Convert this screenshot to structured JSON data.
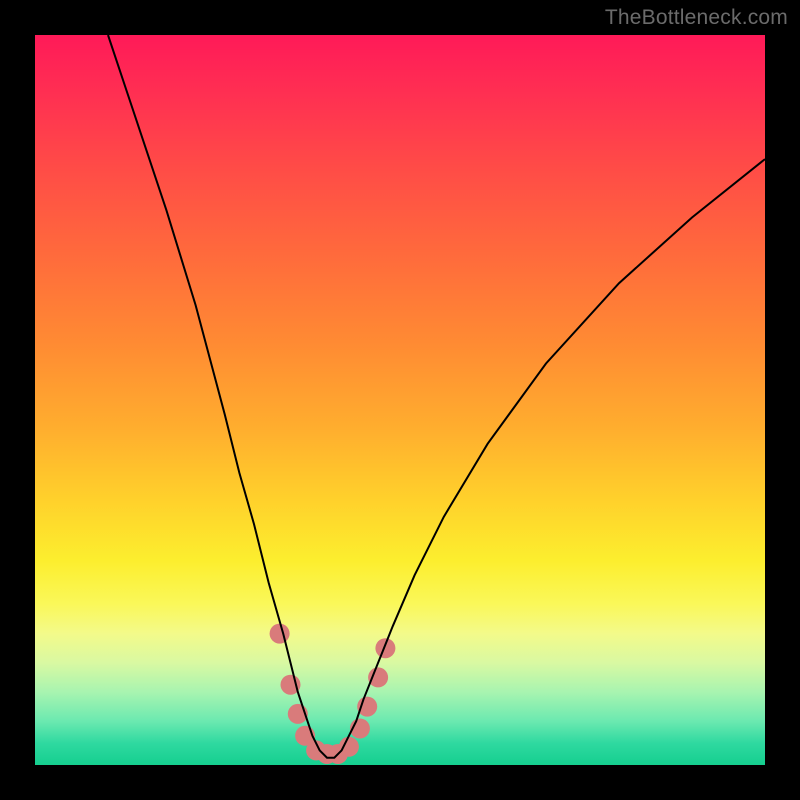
{
  "watermark": {
    "text": "TheBottleneck.com"
  },
  "chart_data": {
    "type": "line",
    "title": "",
    "xlabel": "",
    "ylabel": "",
    "xlim": [
      0,
      100
    ],
    "ylim": [
      0,
      100
    ],
    "grid": false,
    "legend": false,
    "background_gradient": {
      "direction": "vertical",
      "stops": [
        {
          "pos": 0,
          "color": "#ff1a58"
        },
        {
          "pos": 30,
          "color": "#ff6a3c"
        },
        {
          "pos": 64,
          "color": "#ffd22b"
        },
        {
          "pos": 82,
          "color": "#f3fa8a"
        },
        {
          "pos": 100,
          "color": "#15cf8f"
        }
      ]
    },
    "series": [
      {
        "name": "bottleneck-curve",
        "color": "#000000",
        "stroke_width": 2,
        "x": [
          10,
          14,
          18,
          22,
          26,
          28,
          30,
          32,
          34,
          35,
          36,
          37,
          38,
          39,
          40,
          41,
          42,
          43,
          44,
          45,
          47,
          49,
          52,
          56,
          62,
          70,
          80,
          90,
          100
        ],
        "y": [
          100,
          88,
          76,
          63,
          48,
          40,
          33,
          25,
          18,
          14,
          10,
          7,
          4,
          2,
          1,
          1,
          2,
          4,
          6,
          9,
          14,
          19,
          26,
          34,
          44,
          55,
          66,
          75,
          83
        ]
      }
    ],
    "markers": {
      "name": "highlight-dots",
      "color": "#d97b7b",
      "shape": "circle",
      "radius_px": 10,
      "points": [
        {
          "x": 33.5,
          "y": 18
        },
        {
          "x": 35,
          "y": 11
        },
        {
          "x": 36,
          "y": 7
        },
        {
          "x": 37,
          "y": 4
        },
        {
          "x": 38.5,
          "y": 2
        },
        {
          "x": 40,
          "y": 1.5
        },
        {
          "x": 41.5,
          "y": 1.5
        },
        {
          "x": 43,
          "y": 2.5
        },
        {
          "x": 44.5,
          "y": 5
        },
        {
          "x": 45.5,
          "y": 8
        },
        {
          "x": 47,
          "y": 12
        },
        {
          "x": 48,
          "y": 16
        }
      ]
    }
  }
}
